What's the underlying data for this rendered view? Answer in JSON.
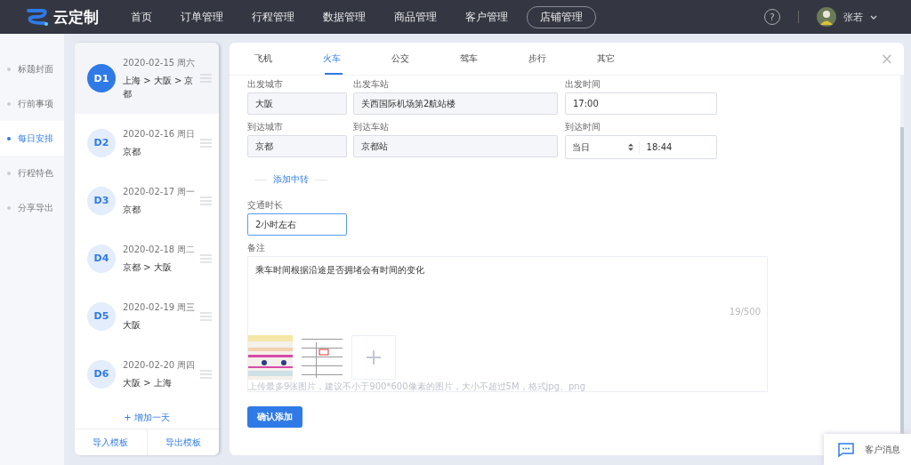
{
  "header": {
    "brand": "云定制",
    "nav": [
      {
        "label": "首页",
        "selected": false,
        "kind": "link"
      },
      {
        "label": "订单管理",
        "selected": false,
        "kind": "link"
      },
      {
        "label": "行程管理",
        "selected": false,
        "kind": "link"
      },
      {
        "label": "数据管理",
        "selected": false,
        "kind": "link"
      },
      {
        "label": "商品管理",
        "selected": false,
        "kind": "link"
      },
      {
        "label": "客户管理",
        "selected": false,
        "kind": "link"
      },
      {
        "label": "店铺管理",
        "selected": false,
        "kind": "outlined"
      }
    ],
    "help": "?",
    "user": "张若"
  },
  "sidebar": {
    "items": [
      {
        "label": "标题封面",
        "selected": false
      },
      {
        "label": "行前事项",
        "selected": false
      },
      {
        "label": "每日安排",
        "selected": true
      },
      {
        "label": "行程特色",
        "selected": false
      },
      {
        "label": "分享导出",
        "selected": false
      }
    ]
  },
  "days": {
    "items": [
      {
        "badge": "D1",
        "date": "2020-02-15 周六",
        "route": "上海 > 大阪 > 京都",
        "selected": true
      },
      {
        "badge": "D2",
        "date": "2020-02-16 周日",
        "route": "京都",
        "selected": false
      },
      {
        "badge": "D3",
        "date": "2020-02-17 周一",
        "route": "京都",
        "selected": false
      },
      {
        "badge": "D4",
        "date": "2020-02-18 周二",
        "route": "京都 > 大阪",
        "selected": false
      },
      {
        "badge": "D5",
        "date": "2020-02-19 周三",
        "route": "大阪",
        "selected": false
      },
      {
        "badge": "D6",
        "date": "2020-02-20 周四",
        "route": "大阪 > 上海",
        "selected": false
      }
    ],
    "add_day": "+ 增加一天",
    "footer": [
      "导入模板",
      "导出模板"
    ]
  },
  "editor": {
    "tabs": [
      {
        "label": "飞机",
        "selected": false
      },
      {
        "label": "火车",
        "selected": true
      },
      {
        "label": "公交",
        "selected": false
      },
      {
        "label": "驾车",
        "selected": false
      },
      {
        "label": "步行",
        "selected": false
      },
      {
        "label": "其它",
        "selected": false
      }
    ],
    "close": "×",
    "depart": {
      "city_label": "出发城市",
      "city": "大阪",
      "station_label": "出发车站",
      "station": "关西国际机场第2航站楼",
      "time_label": "出发时间",
      "time": "17:00"
    },
    "arrive": {
      "city_label": "到达城市",
      "city": "京都",
      "station_label": "到达车站",
      "station": "京都站",
      "time_label": "到达时间",
      "day": "当日",
      "time": "18:44"
    },
    "add_transfer": "添加中转",
    "duration_label": "交通时长",
    "duration": "2小时左右",
    "notes_label": "备注",
    "notes": "乘车时间根据沿途是否拥堵会有时间的变化",
    "counter": "19/500",
    "upload_hint": "上传最多9张图片，建议不小于900*600像素的图片，大小不超过5M，格式jpg、png",
    "submit": "确认添加"
  },
  "chat": {
    "label": "客户消息"
  }
}
